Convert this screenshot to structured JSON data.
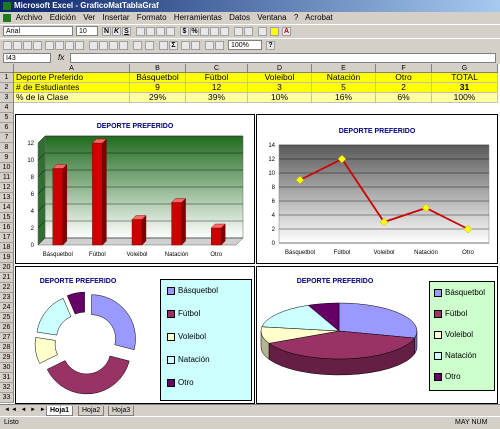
{
  "window": {
    "title": "Microsoft Excel - GraficoMatTablaGraf"
  },
  "menu": [
    "Archivo",
    "Edición",
    "Ver",
    "Insertar",
    "Formato",
    "Herramientas",
    "Datos",
    "Ventana",
    "?",
    "Acrobat"
  ],
  "toolbar": {
    "font": "Arial",
    "size": "10",
    "zoom": "100%"
  },
  "formula": {
    "cell_ref": "I43",
    "fx": "fx"
  },
  "columns": [
    "A",
    "B",
    "C",
    "D",
    "E",
    "F",
    "G"
  ],
  "rows": [
    "1",
    "2",
    "3",
    "4",
    "5",
    "6",
    "7",
    "8",
    "9",
    "10",
    "11",
    "12",
    "13",
    "14",
    "15",
    "16",
    "17",
    "18",
    "19",
    "20",
    "21",
    "22",
    "23",
    "24",
    "25",
    "26",
    "27",
    "28",
    "29",
    "30",
    "31",
    "32",
    "33"
  ],
  "table": {
    "headers": [
      "Deporte Preferido",
      "Básquetbol",
      "Fútbol",
      "Voleibol",
      "Natación",
      "Otro",
      "TOTAL"
    ],
    "row2": [
      "# de Estudiantes",
      "9",
      "12",
      "3",
      "5",
      "2",
      "31"
    ],
    "row3": [
      "% de la Clase",
      "29%",
      "39%",
      "10%",
      "16%",
      "6%",
      "100%"
    ]
  },
  "chart_data": [
    {
      "type": "bar",
      "title": "DEPORTE PREFERIDO",
      "categories": [
        "Básquetbol",
        "Fútbol",
        "Voleibol",
        "Natación",
        "Otro"
      ],
      "values": [
        9,
        12,
        3,
        5,
        2
      ],
      "ylim": [
        0,
        12
      ],
      "yticks": [
        "0",
        "2",
        "4",
        "6",
        "8",
        "10",
        "12"
      ],
      "colors": {
        "bar": "#cc0000",
        "wall": "#2f7a2f"
      }
    },
    {
      "type": "line",
      "title": "DEPORTE PREFERIDO",
      "categories": [
        "Básquetbol",
        "Fútbol",
        "Voleibol",
        "Natación",
        "Otro"
      ],
      "values": [
        9,
        12,
        3,
        5,
        2
      ],
      "ylim": [
        0,
        14
      ],
      "yticks": [
        "0",
        "2",
        "4",
        "6",
        "8",
        "10",
        "12",
        "14"
      ],
      "colors": {
        "line": "#cc0000",
        "marker": "#ffff00"
      }
    },
    {
      "type": "pie",
      "title": "DEPORTE PREFERIDO",
      "categories": [
        "Básquetbol",
        "Fútbol",
        "Voleibol",
        "Natación",
        "Otro"
      ],
      "values": [
        9,
        12,
        3,
        5,
        2
      ],
      "legend": "right"
    },
    {
      "type": "pie",
      "title": "DEPORTE PREFERIDO",
      "categories": [
        "Básquetbol",
        "Fútbol",
        "Voleibol",
        "Natación",
        "Otro"
      ],
      "values": [
        9,
        12,
        3,
        5,
        2
      ],
      "legend": "right"
    }
  ],
  "colors": {
    "basquetbol": "#9999ff",
    "futbol": "#993366",
    "voleibol": "#ffffcc",
    "natacion": "#ccffff",
    "otro": "#660066",
    "legend_bg": "#ccffff",
    "legend_bg2": "#ccffcc"
  },
  "sheets": [
    "Hoja1",
    "Hoja2",
    "Hoja3"
  ],
  "status": {
    "left": "Listo",
    "right": "MAY NUM"
  }
}
